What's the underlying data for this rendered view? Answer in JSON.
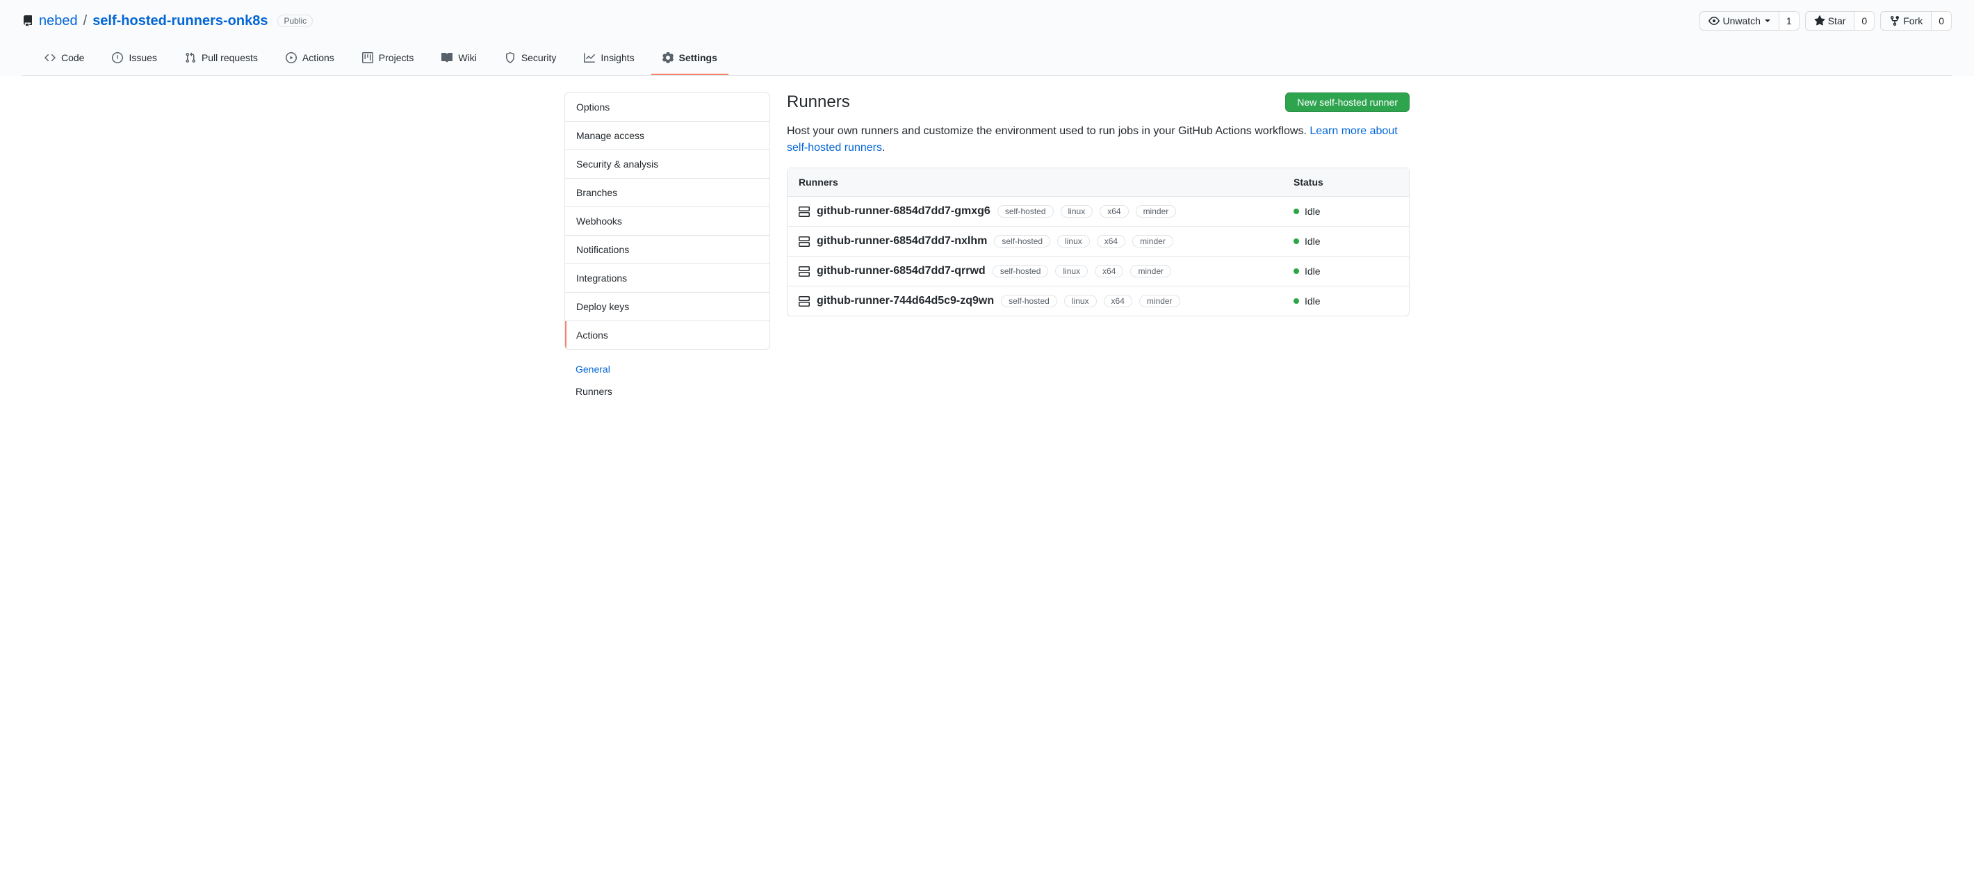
{
  "repo": {
    "owner": "nebed",
    "name": "self-hosted-runners-onk8s",
    "visibility": "Public"
  },
  "actions": {
    "unwatch": "Unwatch",
    "unwatch_count": "1",
    "star": "Star",
    "star_count": "0",
    "fork": "Fork",
    "fork_count": "0"
  },
  "nav": {
    "code": "Code",
    "issues": "Issues",
    "pulls": "Pull requests",
    "actions": "Actions",
    "projects": "Projects",
    "wiki": "Wiki",
    "security": "Security",
    "insights": "Insights",
    "settings": "Settings"
  },
  "sidebar": {
    "items": [
      "Options",
      "Manage access",
      "Security & analysis",
      "Branches",
      "Webhooks",
      "Notifications",
      "Integrations",
      "Deploy keys",
      "Actions"
    ],
    "sub": {
      "general": "General",
      "runners": "Runners"
    }
  },
  "page": {
    "title": "Runners",
    "new_button": "New self-hosted runner",
    "description_prefix": "Host your own runners and customize the environment used to run jobs in your GitHub Actions workflows. ",
    "learn_more": "Learn more about self-hosted runners",
    "period": "."
  },
  "table": {
    "col_runners": "Runners",
    "col_status": "Status",
    "rows": [
      {
        "name": "github-runner-6854d7dd7-gmxg6",
        "labels": [
          "self-hosted",
          "linux",
          "x64",
          "minder"
        ],
        "status": "Idle"
      },
      {
        "name": "github-runner-6854d7dd7-nxlhm",
        "labels": [
          "self-hosted",
          "linux",
          "x64",
          "minder"
        ],
        "status": "Idle"
      },
      {
        "name": "github-runner-6854d7dd7-qrrwd",
        "labels": [
          "self-hosted",
          "linux",
          "x64",
          "minder"
        ],
        "status": "Idle"
      },
      {
        "name": "github-runner-744d64d5c9-zq9wn",
        "labels": [
          "self-hosted",
          "linux",
          "x64",
          "minder"
        ],
        "status": "Idle"
      }
    ]
  }
}
